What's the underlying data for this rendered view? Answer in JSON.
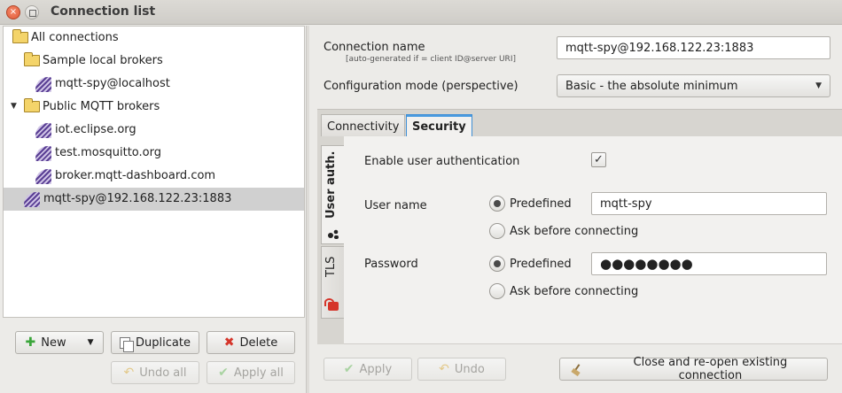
{
  "window": {
    "title": "Connection list",
    "close_glyph": "×"
  },
  "tree": {
    "root": {
      "label": "All connections",
      "icon": "folder-icon"
    },
    "groups": [
      {
        "label": "Sample local brokers",
        "icon": "folder-icon",
        "items": [
          {
            "label": "mqtt-spy@localhost",
            "icon": "connection-icon"
          }
        ]
      },
      {
        "label": "Public MQTT brokers",
        "icon": "folder-icon",
        "expanded": true,
        "expander_glyph": "▼",
        "items": [
          {
            "label": "iot.eclipse.org",
            "icon": "connection-icon"
          },
          {
            "label": "test.mosquitto.org",
            "icon": "connection-icon"
          },
          {
            "label": "broker.mqtt-dashboard.com",
            "icon": "connection-icon"
          }
        ]
      }
    ],
    "selected_item": {
      "label": "mqtt-spy@192.168.122.23:1883",
      "icon": "connection-icon"
    }
  },
  "list_actions": {
    "new_label": "New",
    "new_glyph": "✚",
    "new_caret": "▼",
    "duplicate_label": "Duplicate",
    "delete_label": "Delete",
    "delete_glyph": "✖",
    "undo_all_label": "Undo all",
    "undo_glyph": "↶",
    "apply_all_label": "Apply all",
    "apply_glyph": "✔"
  },
  "connection": {
    "name_label": "Connection name",
    "name_hint": "[auto-generated if = client ID@server URI]",
    "name_value": "mqtt-spy@192.168.122.23:1883",
    "mode_label": "Configuration mode (perspective)",
    "mode_value": "Basic - the absolute minimum",
    "mode_caret": "▼"
  },
  "tabs": [
    {
      "label": "Connectivity",
      "active": false
    },
    {
      "label": "Security",
      "active": true
    }
  ],
  "side_tabs": [
    {
      "label": "User auth.",
      "icon": "user-icon",
      "active": true
    },
    {
      "label": "TLS",
      "icon": "lock-icon",
      "active": false
    }
  ],
  "security": {
    "enable_label": "Enable user authentication",
    "enable_checked": true,
    "check_glyph": "✓",
    "username": {
      "label": "User name",
      "predefined_label": "Predefined",
      "ask_label": "Ask before connecting",
      "mode": "predefined",
      "value": "mqtt-spy"
    },
    "password": {
      "label": "Password",
      "predefined_label": "Predefined",
      "ask_label": "Ask before connecting",
      "mode": "predefined",
      "masked_value": "●●●●●●●●"
    }
  },
  "footer_actions": {
    "apply_label": "Apply",
    "undo_label": "Undo",
    "reopen_label": "Close and re-open existing connection"
  },
  "colors": {
    "accent": "#3f8fd6",
    "selection": "#d0d0d0",
    "folder": "#f4d46a",
    "connection_icon": "#5a3f94",
    "add_green": "#3aa53a",
    "delete_red": "#d5352a"
  }
}
